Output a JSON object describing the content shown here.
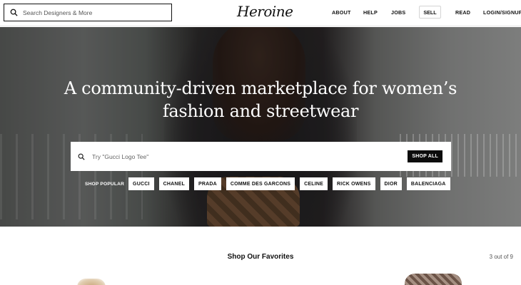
{
  "header": {
    "search_placeholder": "Search Designers & More",
    "logo_text": "Heroine",
    "nav": {
      "about": "ABOUT",
      "help": "HELP",
      "jobs": "JOBS",
      "sell": "SELL",
      "read": "READ",
      "login": "LOGIN/SIGNUP"
    }
  },
  "hero": {
    "title_line1": "A community-driven marketplace for women’s",
    "title_line2": "fashion and streetwear",
    "search_placeholder": "Try \"Gucci Logo Tee\"",
    "shop_all": "SHOP ALL",
    "popular_label": "SHOP POPULAR",
    "popular_brands": [
      "GUCCI",
      "CHANEL",
      "PRADA",
      "COMME DES GARCONS",
      "CELINE",
      "RICK OWENS",
      "DIOR",
      "BALENCIAGA"
    ]
  },
  "favorites": {
    "title": "Shop Our Favorites",
    "count": "3 out of 9"
  },
  "icons": {
    "header_search": "search-icon",
    "hero_search": "search-icon"
  }
}
